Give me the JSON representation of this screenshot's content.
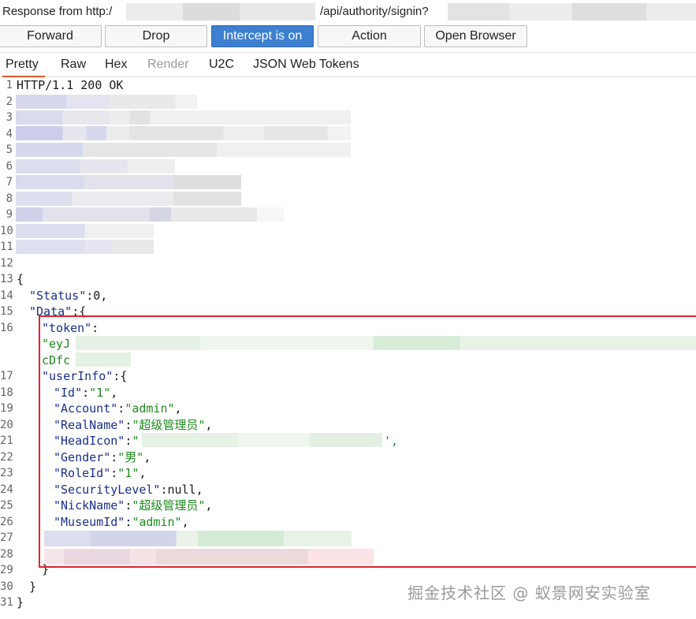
{
  "title_bar": {
    "prefix": "Response from http:/",
    "suffix": "/api/authority/signin?"
  },
  "toolbar": {
    "forward": "Forward",
    "drop": "Drop",
    "intercept": "Intercept is on",
    "action": "Action",
    "open_browser": "Open Browser"
  },
  "tabs": [
    "Pretty",
    "Raw",
    "Hex",
    "Render",
    "U2C",
    "JSON Web Tokens"
  ],
  "line_numbers": [
    "1",
    "2",
    "3",
    "4",
    "5",
    "6",
    "7",
    "8",
    "9",
    "10",
    "11",
    "12",
    "13",
    "14",
    "15",
    "16",
    "17",
    "18",
    "19",
    "20",
    "21",
    "22",
    "23",
    "24",
    "25",
    "26",
    "27",
    "28",
    "29",
    "30",
    "31"
  ],
  "code": {
    "status_line": "HTTP/1.1 200 OK",
    "open_brace": "{",
    "status_key": "\"Status\"",
    "status_val": "0,",
    "data_key": "\"Data\"",
    "data_open": ":{",
    "token_key": "\"token\"",
    "token_colon": ":",
    "token_start": "\"eyJ",
    "token_cont": "cDfc",
    "userinfo_key": "\"userInfo\"",
    "userinfo_open": ":{",
    "id_key": "\"Id\"",
    "id_val": "\"1\"",
    "account_key": "\"Account\"",
    "account_val": "\"admin\"",
    "realname_key": "\"RealName\"",
    "realname_val": "\"超级管理员\"",
    "headicon_key": "\"HeadIcon\"",
    "headicon_val": "\"",
    "headicon_end": "',",
    "gender_key": "\"Gender\"",
    "gender_val": "\"男\"",
    "roleid_key": "\"RoleId\"",
    "roleid_val": "\"1\"",
    "seclevel_key": "\"SecurityLevel\"",
    "seclevel_val": "null",
    "nickname_key": "\"NickName\"",
    "nickname_val": "\"超级管理员\"",
    "museumid_key": "\"MuseumId\"",
    "museumid_val": "\"admin\"",
    "close_inner": "}",
    "close_data": "}",
    "close_root": "}"
  },
  "watermark": "掘金技术社区 @ 蚁景网安实验室",
  "colors": {
    "accent_button": "#3e7fd0",
    "tab_underline": "#e05a28",
    "highlight_box": "#e0242e",
    "string": "#1f8a1f",
    "key": "#1a2f8c"
  }
}
